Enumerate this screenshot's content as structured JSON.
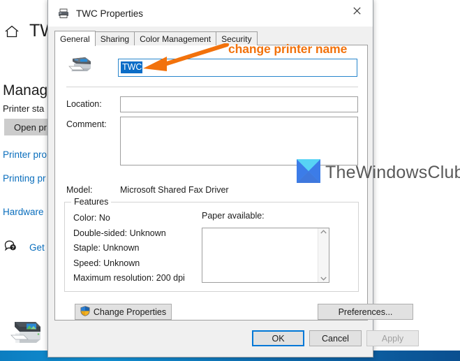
{
  "background": {
    "home_icon": "home-icon",
    "title": "TW",
    "heading": "Manage",
    "printer_status_label": "Printer sta",
    "open_button": "Open pr",
    "links": [
      "Printer pro",
      "Printing pr",
      "Hardware"
    ],
    "help_icon": "question-bubble-icon",
    "help_link": "Get h",
    "printer_graphic": "printer-icon"
  },
  "dialog": {
    "title": "TWC Properties",
    "title_icon": "printer-icon",
    "close_icon": "close-icon",
    "tabs": [
      {
        "label": "General",
        "active": true
      },
      {
        "label": "Sharing",
        "active": false
      },
      {
        "label": "Color Management",
        "active": false
      },
      {
        "label": "Security",
        "active": false
      }
    ],
    "general": {
      "printer_icon": "printer-icon",
      "printer_name_value": "TWC",
      "printer_name_selected": true,
      "location_label": "Location:",
      "location_value": "",
      "comment_label": "Comment:",
      "comment_value": "",
      "model_label": "Model:",
      "model_value": "Microsoft Shared Fax Driver",
      "features_group_title": "Features",
      "features": [
        "Color: No",
        "Double-sided: Unknown",
        "Staple: Unknown",
        "Speed: Unknown",
        "Maximum resolution: 200 dpi"
      ],
      "paper_available_label": "Paper available:",
      "paper_available_items": [],
      "scroll_up_icon": "chevron-up-icon",
      "scroll_down_icon": "chevron-down-icon",
      "change_properties_button": "Change Properties",
      "change_properties_icon": "uac-shield-icon",
      "preferences_button": "Preferences..."
    },
    "footer": {
      "ok_button": "OK",
      "cancel_button": "Cancel",
      "apply_button": "Apply",
      "apply_disabled": true
    }
  },
  "annotation": {
    "text": "change printer name",
    "color": "#f2720c",
    "arrow_icon": "left-arrow-icon"
  },
  "watermark": {
    "logo_icon": "bowtie-logo-icon",
    "text": "TheWindowsClub"
  },
  "colors": {
    "accent_blue": "#0078d7",
    "selection_blue": "#0b6dc7",
    "annotation_orange": "#f2720c",
    "link_blue": "#0a6ebd",
    "dialog_bg": "#f0f0f0"
  }
}
